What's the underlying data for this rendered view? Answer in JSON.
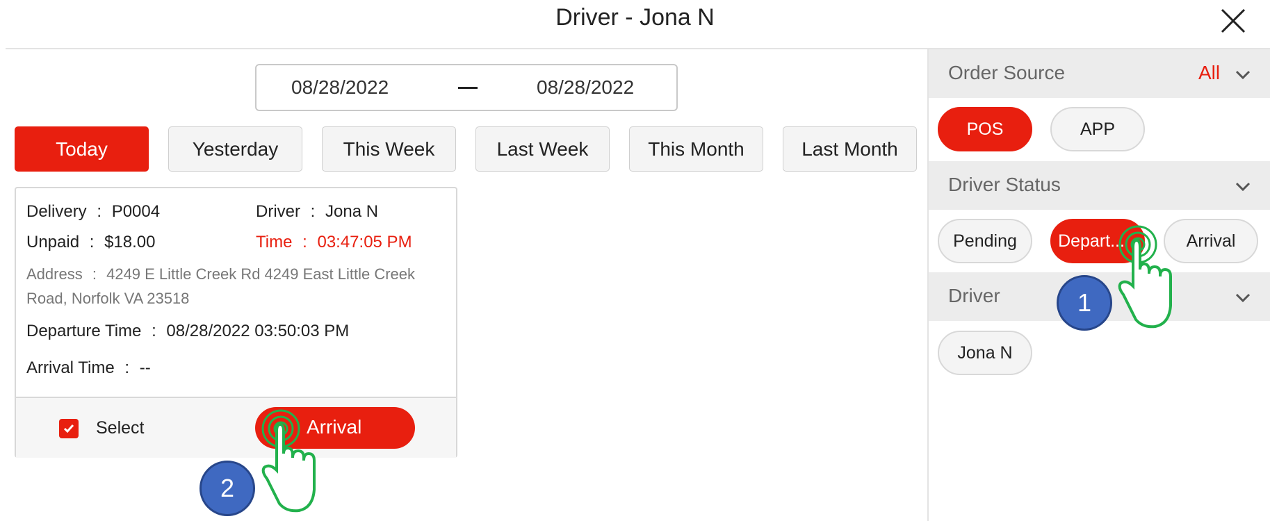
{
  "header": {
    "title": "Driver - Jona N"
  },
  "date_range": {
    "from": "08/28/2022",
    "to": "08/28/2022"
  },
  "range_buttons": {
    "today": "Today",
    "yesterday": "Yesterday",
    "this_week": "This Week",
    "last_week": "Last Week",
    "this_month": "This Month",
    "last_month": "Last Month"
  },
  "order_card": {
    "delivery_label": "Delivery",
    "delivery_value": "P0004",
    "driver_label": "Driver",
    "driver_value": "Jona N",
    "unpaid_label": "Unpaid",
    "unpaid_value": "$18.00",
    "time_label": "Time",
    "time_value": "03:47:05 PM",
    "address_label": "Address",
    "address_line1": "4249 E Little Creek Rd 4249 East Little Creek",
    "address_line2": "Road, Norfolk VA 23518",
    "departure_label": "Departure Time",
    "departure_value": "08/28/2022 03:50:03 PM",
    "arrival_label": "Arrival Time",
    "arrival_value": "--",
    "separator": ":",
    "select_label": "Select",
    "selected": true,
    "arrival_button": "Arrival"
  },
  "filters": {
    "order_source": {
      "label": "Order Source",
      "value": "All",
      "options": [
        "POS",
        "APP"
      ],
      "active": "POS"
    },
    "driver_status": {
      "label": "Driver Status",
      "options": [
        "Pending",
        "Depart...",
        "Arrival"
      ],
      "active": "Depart..."
    },
    "driver": {
      "label": "Driver",
      "options": [
        "Jona N"
      ]
    }
  },
  "annotations": {
    "step1": "1",
    "step2": "2"
  },
  "colors": {
    "accent": "#e81f0f",
    "badge": "#3f69c1",
    "hand": "#22b14c"
  },
  "icons": {
    "close": "close-icon",
    "chevron": "chevron-down-icon",
    "check": "check-icon",
    "hand": "tap-hand-icon"
  }
}
